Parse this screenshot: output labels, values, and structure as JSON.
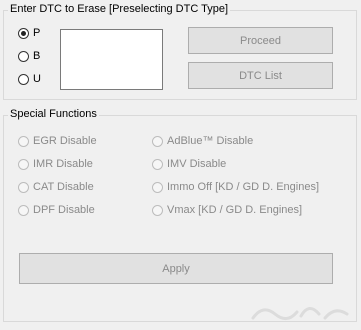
{
  "dtc_group": {
    "title": "Enter DTC to Erase [Preselecting DTC Type]",
    "radios": [
      {
        "label": "P",
        "checked": true
      },
      {
        "label": "B",
        "checked": false
      },
      {
        "label": "U",
        "checked": false
      }
    ],
    "input_value": "",
    "proceed_label": "Proceed",
    "dtc_list_label": "DTC List"
  },
  "special_group": {
    "title": "Special Functions",
    "left_options": [
      {
        "label": "EGR Disable"
      },
      {
        "label": "IMR Disable"
      },
      {
        "label": "CAT Disable"
      },
      {
        "label": "DPF Disable"
      }
    ],
    "right_options": [
      {
        "label": "AdBlue™ Disable"
      },
      {
        "label": "IMV Disable"
      },
      {
        "label": "Immo Off [KD / GD D. Engines]"
      },
      {
        "label": "Vmax [KD / GD D. Engines]"
      }
    ],
    "apply_label": "Apply"
  },
  "colors": {
    "background": "#f0f0f0",
    "disabled_text": "#8a8a8a",
    "button_face": "#e1e1e1",
    "border": "#d9d9d9"
  }
}
